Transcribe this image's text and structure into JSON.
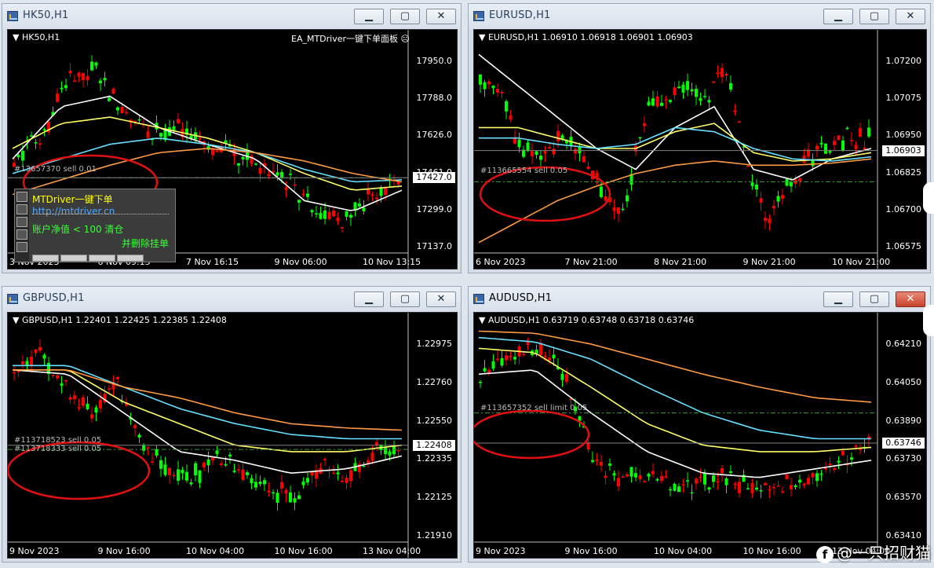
{
  "windows": [
    {
      "title": "HK50,H1",
      "active": false,
      "close_red": false,
      "header": "HK50,H1",
      "ea_label": "EA_MTDriver一键下单面板 ☹",
      "price_tag": "17427.0",
      "yticks": [
        "17950.0",
        "17788.0",
        "17626.0",
        "17461.0",
        "17299.0",
        "17137.0"
      ],
      "xticks": [
        "3 Nov 2023",
        "6 Nov 09:15",
        "7 Nov 16:15",
        "9 Nov 06:00",
        "10 Nov 13:15"
      ],
      "orders": [
        "#13657370 sell 0.01"
      ]
    },
    {
      "title": "EURUSD,H1",
      "active": false,
      "close_red": false,
      "header": "EURUSD,H1  1.06910 1.06918 1.06901 1.06903",
      "ea_label": "",
      "price_tag": "1.06903",
      "yticks": [
        "1.07200",
        "1.07075",
        "1.06950",
        "1.06825",
        "1.06700",
        "1.06575"
      ],
      "xticks": [
        "6 Nov 2023",
        "7 Nov 21:00",
        "8 Nov 21:00",
        "9 Nov 21:00",
        "10 Nov 21:00"
      ],
      "orders": [
        "#113665554 sell 0.05"
      ]
    },
    {
      "title": "GBPUSD,H1",
      "active": false,
      "close_red": false,
      "header": "GBPUSD,H1  1.22401 1.22425 1.22385 1.22408",
      "ea_label": "",
      "price_tag": "1.22408",
      "yticks": [
        "1.22975",
        "1.22760",
        "1.22550",
        "1.22335",
        "1.22125",
        "1.21910"
      ],
      "xticks": [
        "9 Nov 2023",
        "9 Nov 16:00",
        "10 Nov 04:00",
        "10 Nov 16:00",
        "13 Nov 04:00"
      ],
      "orders": [
        "#113718523 sell 0.05",
        "#113718333 sell 0.05"
      ]
    },
    {
      "title": "AUDUSD,H1",
      "active": true,
      "close_red": true,
      "header": "AUDUSD,H1  0.63719 0.63748 0.63718 0.63746",
      "ea_label": "",
      "price_tag": "0.63746",
      "yticks": [
        "0.64210",
        "0.64050",
        "0.63890",
        "0.63730",
        "0.63570",
        "0.63410"
      ],
      "xticks": [
        "9 Nov 2023",
        "9 Nov 16:00",
        "10 Nov 04:00",
        "10 Nov 16:00",
        "13 Nov 04:00"
      ],
      "orders": [
        "#113657352 sell limit 0.05"
      ]
    }
  ],
  "ea_panel": {
    "title": "MTDriver一键下单",
    "url": "http://mtdriver.cn",
    "line1": "账户净值 < 100 清仓",
    "line2": "并删除挂单"
  },
  "watermark": "@一只招财猫",
  "colors": {
    "bull": "#00ff00",
    "bear": "#ff0000",
    "ma_white": "#ffffff",
    "ma_yellow": "#ffff66",
    "ma_cyan": "#66e0ff",
    "ma_orange": "#ff9a40",
    "circle": "#e01010"
  }
}
